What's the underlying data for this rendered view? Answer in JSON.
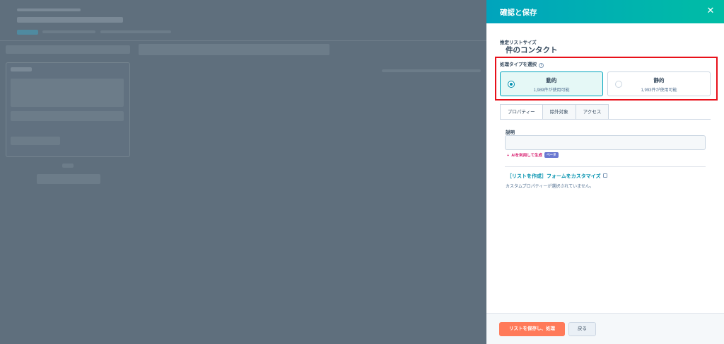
{
  "panel": {
    "title": "確認と保存",
    "close_glyph": "✕"
  },
  "estimate": {
    "label": "推定リストサイズ",
    "value": "件のコンタクト"
  },
  "processing_type": {
    "label": "処理タイプを選択",
    "info_glyph": "i",
    "options": [
      {
        "title": "動的",
        "subtitle": "1,989件が使用可能",
        "selected": true
      },
      {
        "title": "静的",
        "subtitle": "1,993件が使用可能",
        "selected": false
      }
    ]
  },
  "tabs": [
    {
      "label": "プロパティー",
      "active": true
    },
    {
      "label": "除外対象",
      "active": false
    },
    {
      "label": "アクセス",
      "active": false
    }
  ],
  "description": {
    "label": "説明",
    "value": ""
  },
  "ai": {
    "label": "AIを利用して生成",
    "badge": "ベータ",
    "plus": "+"
  },
  "customize": {
    "link": "［リストを作成］フォームをカスタマイズ",
    "empty_text": "カスタムプロパティーが選択されていません。"
  },
  "footer": {
    "save_label": "リストを保存し、処理",
    "back_label": "戻る"
  },
  "colors": {
    "header_start": "#00a4bd",
    "header_end": "#00bda5",
    "primary_button": "#ff7a59",
    "highlight_border": "#e8101a",
    "selected_card_bg": "#e5f8f6"
  }
}
